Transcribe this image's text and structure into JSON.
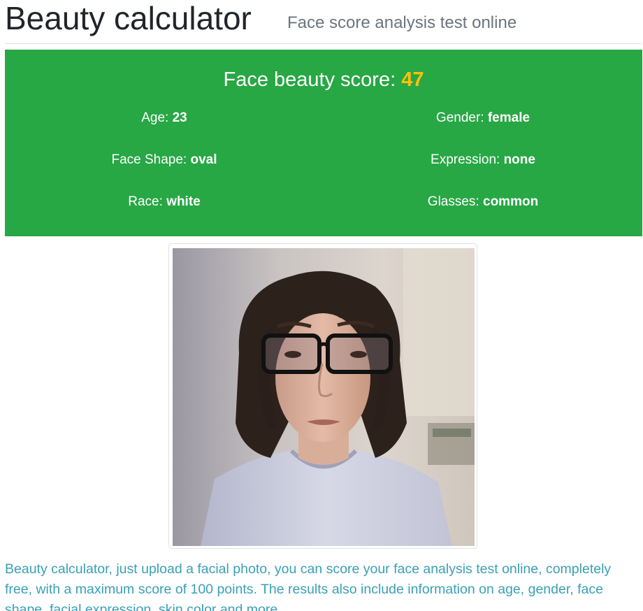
{
  "header": {
    "title": "Beauty calculator",
    "subtitle": "Face score analysis test online"
  },
  "result": {
    "score_label": "Face beauty score:",
    "score_value": "47",
    "attributes": {
      "age": {
        "label": "Age:",
        "value": "23"
      },
      "gender": {
        "label": "Gender:",
        "value": "female"
      },
      "face_shape": {
        "label": "Face Shape:",
        "value": "oval"
      },
      "expression": {
        "label": "Expression:",
        "value": "none"
      },
      "race": {
        "label": "Race:",
        "value": "white"
      },
      "glasses": {
        "label": "Glasses:",
        "value": "common"
      }
    },
    "colors": {
      "panel_bg": "#28a745",
      "score_accent": "#ffc107"
    }
  },
  "photo": {
    "subject": "face-photo"
  },
  "description": "Beauty calculator, just upload a facial photo, you can score your face analysis test online, completely free, with a maximum score of 100 points. The results also include information on age, gender, face shape, facial expression, skin color and more."
}
